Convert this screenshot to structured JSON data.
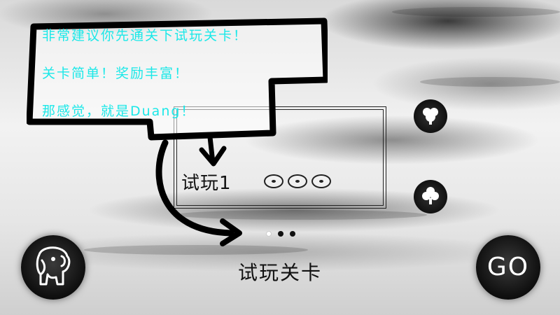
{
  "hint": {
    "lines": [
      "非常建议你先通关下试玩关卡！",
      "关卡简单！奖励丰富！",
      "那感觉，就是Duang！"
    ],
    "text_color": "#1ce8e8"
  },
  "level_card": {
    "name": "试玩1",
    "rating_icons": [
      "eye-icon",
      "eye-icon",
      "eye-icon"
    ]
  },
  "pager": {
    "count": 3,
    "active_index": 0
  },
  "mode_title": "试玩关卡",
  "buttons": {
    "go_label": "GO",
    "left_icon": "elephant-icon",
    "side_icons": [
      "flower-icon",
      "flower-icon"
    ]
  }
}
